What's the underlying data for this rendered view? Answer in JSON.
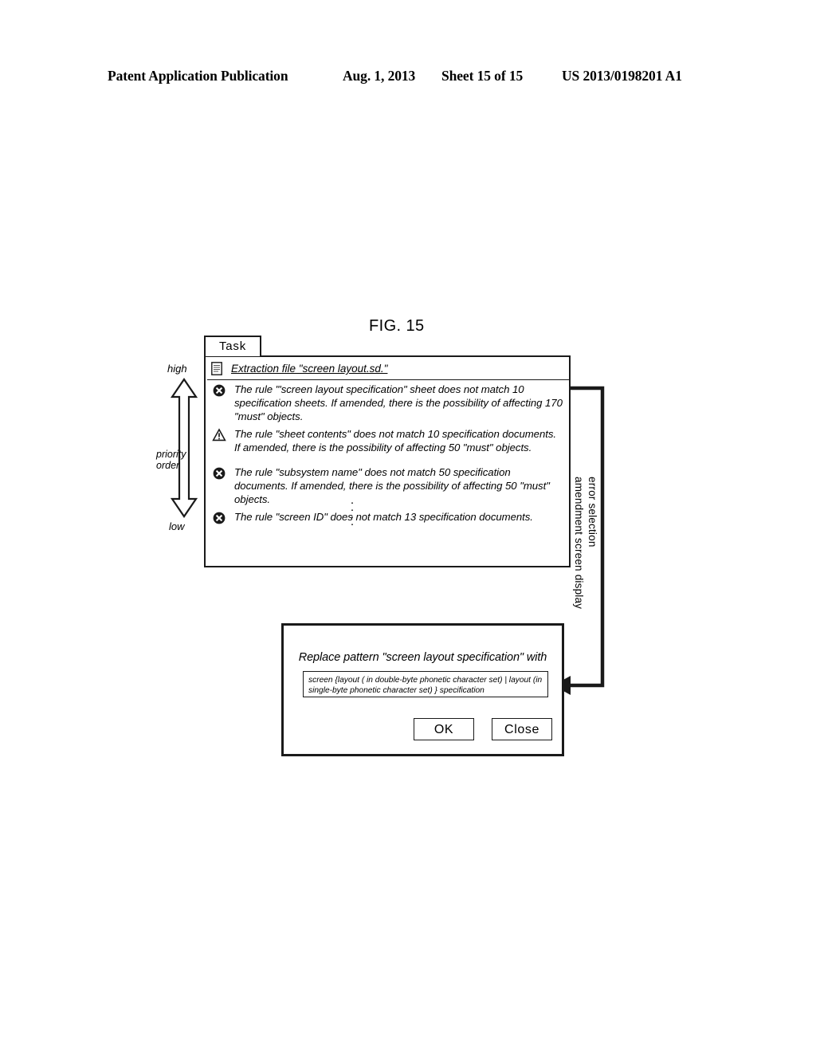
{
  "header": {
    "publication": "Patent Application Publication",
    "date": "Aug. 1, 2013",
    "sheet": "Sheet 15 of 15",
    "number": "US 2013/0198201 A1"
  },
  "figure": {
    "label": "FIG. 15"
  },
  "priority_axis": {
    "high_label": "high",
    "low_label": "low",
    "axis_label": "priority\norder",
    "arrow_icon": "double-headed-vertical-arrow"
  },
  "task_window": {
    "tab_label": "Task",
    "file_row": {
      "icon": "file-icon",
      "label": "Extraction file \"screen layout.sd.\""
    },
    "errors": [
      {
        "icon": "error-circle-x-icon",
        "text": "The rule \"'screen layout specification\" sheet does not  match 10 specification sheets. If amended, there is the possibility of affecting 170 \"must\" objects."
      },
      {
        "icon": "warning-triangle-icon",
        "text": "The rule \"sheet contents\" does not match 10 specification documents. If amended, there is the possibility of affecting 50 \"must\" objects."
      },
      {
        "icon": "error-circle-x-icon",
        "text": "The rule \"subsystem name\" does not match 50 specification documents. If amended, there is the possibility of affecting 50 \"must\" objects."
      },
      {
        "icon": "error-circle-x-icon",
        "text": "The rule \"screen ID\" does not match 13 specification documents."
      }
    ],
    "ellipsis": "·"
  },
  "side_caption": {
    "text": "error selection\namendment screen display"
  },
  "replace_dialog": {
    "title": "Replace pattern \"screen layout specification\" with",
    "input_value": "screen {layout ( in double-byte phonetic character  set) | layout (in single-byte phonetic character set) } specification",
    "ok_label": "OK",
    "close_label": "Close"
  },
  "colors": {
    "ink": "#1a1a1a",
    "paper": "#ffffff"
  }
}
